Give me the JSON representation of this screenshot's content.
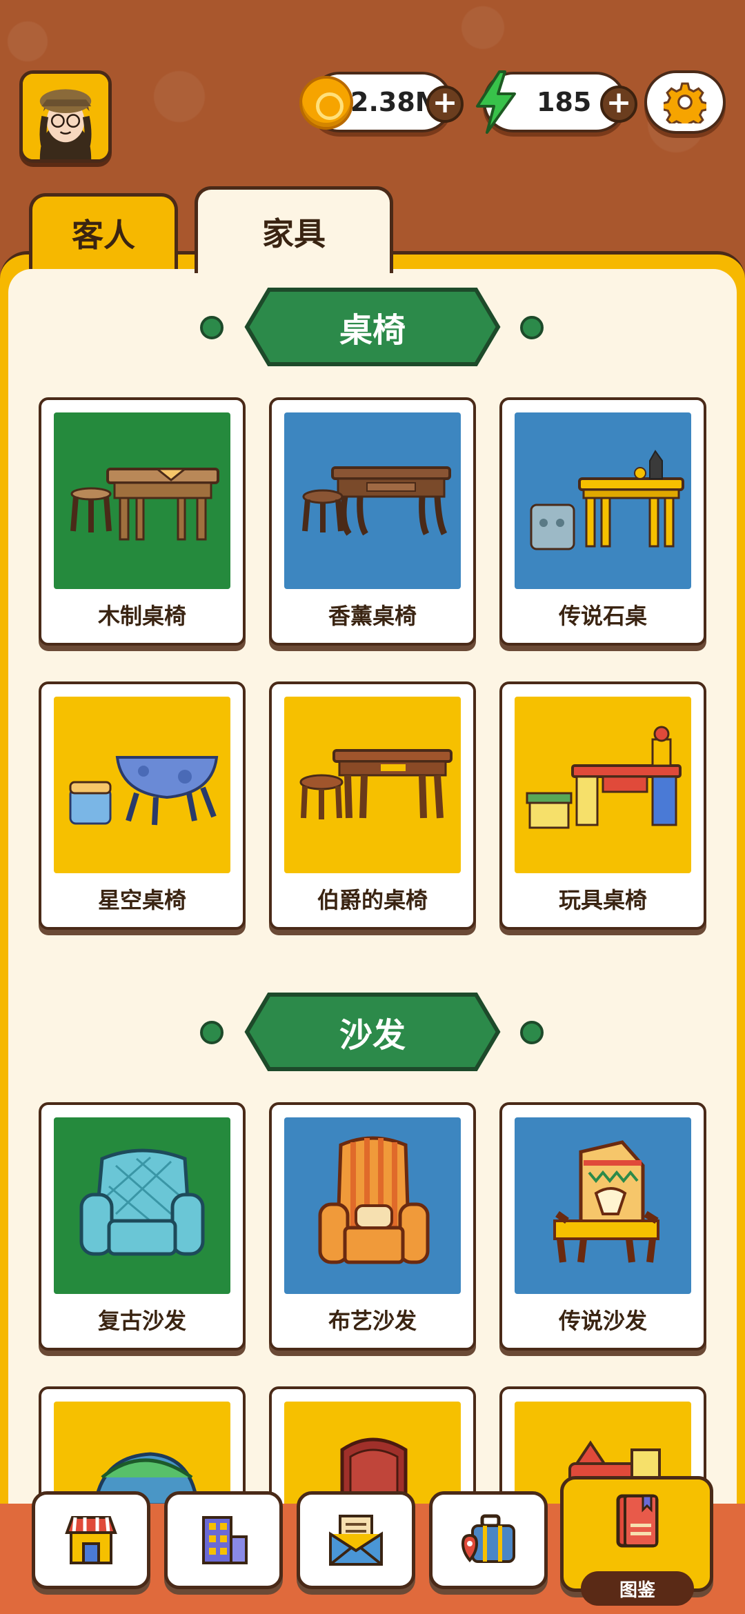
{
  "header": {
    "coins": "2.38M",
    "energy": "185"
  },
  "tabs": [
    {
      "label": "客人",
      "active": false
    },
    {
      "label": "家具",
      "active": true
    }
  ],
  "sections": [
    {
      "title": "桌椅",
      "items": [
        {
          "name": "木制桌椅",
          "bg": "green"
        },
        {
          "name": "香薰桌椅",
          "bg": "blue"
        },
        {
          "name": "传说石桌",
          "bg": "blue"
        },
        {
          "name": "星空桌椅",
          "bg": "yellow"
        },
        {
          "name": "伯爵的桌椅",
          "bg": "yellow"
        },
        {
          "name": "玩具桌椅",
          "bg": "yellow"
        }
      ]
    },
    {
      "title": "沙发",
      "items": [
        {
          "name": "复古沙发",
          "bg": "green"
        },
        {
          "name": "布艺沙发",
          "bg": "blue"
        },
        {
          "name": "传说沙发",
          "bg": "blue"
        }
      ]
    }
  ],
  "bottom_nav": {
    "active_label": "图鉴"
  },
  "colors": {
    "rarity_green": "#258a3d",
    "rarity_blue": "#3d86c0",
    "rarity_yellow": "#f6c000",
    "banner": "#2c8a4a"
  },
  "icons": [
    "avatar",
    "coin-icon",
    "energy-bolt-icon",
    "plus-icon",
    "gear-icon",
    "shop-icon",
    "building-icon",
    "mail-icon",
    "luggage-icon",
    "book-icon"
  ]
}
